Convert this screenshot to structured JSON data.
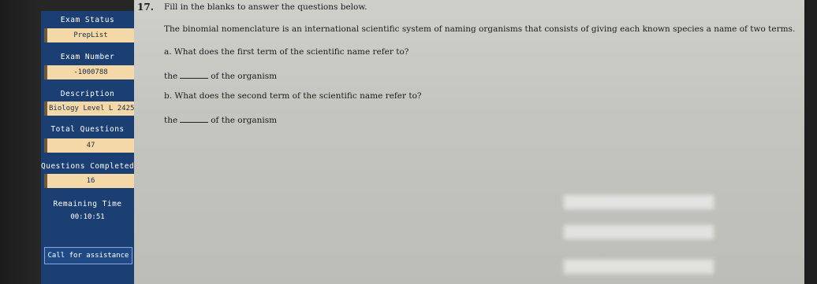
{
  "sidebar": {
    "exam_status_label": "Exam Status",
    "exam_status_value": "PrepList",
    "exam_number_label": "Exam Number",
    "exam_number_value": "-1000788",
    "description_label": "Description",
    "description_value": "Biology Level L 2425",
    "total_questions_label": "Total Questions",
    "total_questions_value": "47",
    "questions_completed_label": "Questions Completed",
    "questions_completed_value": "16",
    "remaining_time_label": "Remaining Time",
    "remaining_time_value": "00:10:51",
    "assist_label": "Call for assistance"
  },
  "question": {
    "number": "17.",
    "instruction": "Fill in the blanks to answer the questions below.",
    "intro": "The binomial nomenclature is an international scientific system of naming organisms that consists of giving each known species a name of two terms.",
    "part_a": "a. What does the first term of the scientific name refer to?",
    "part_a_prefix": "the",
    "part_a_suffix": "of the organism",
    "part_b": "b. What does the second term of the scientific name refer to?",
    "part_b_prefix": "the",
    "part_b_suffix": "of the organism"
  }
}
